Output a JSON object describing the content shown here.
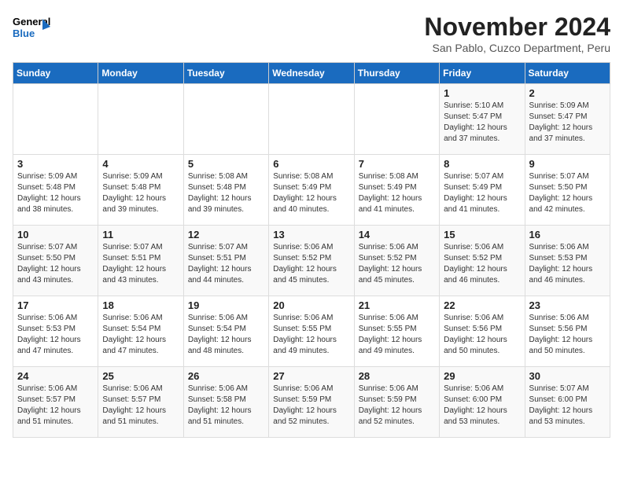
{
  "logo": {
    "line1": "General",
    "line2": "Blue"
  },
  "title": "November 2024",
  "location": "San Pablo, Cuzco Department, Peru",
  "weekdays": [
    "Sunday",
    "Monday",
    "Tuesday",
    "Wednesday",
    "Thursday",
    "Friday",
    "Saturday"
  ],
  "weeks": [
    [
      {
        "day": "",
        "detail": ""
      },
      {
        "day": "",
        "detail": ""
      },
      {
        "day": "",
        "detail": ""
      },
      {
        "day": "",
        "detail": ""
      },
      {
        "day": "",
        "detail": ""
      },
      {
        "day": "1",
        "detail": "Sunrise: 5:10 AM\nSunset: 5:47 PM\nDaylight: 12 hours\nand 37 minutes."
      },
      {
        "day": "2",
        "detail": "Sunrise: 5:09 AM\nSunset: 5:47 PM\nDaylight: 12 hours\nand 37 minutes."
      }
    ],
    [
      {
        "day": "3",
        "detail": "Sunrise: 5:09 AM\nSunset: 5:48 PM\nDaylight: 12 hours\nand 38 minutes."
      },
      {
        "day": "4",
        "detail": "Sunrise: 5:09 AM\nSunset: 5:48 PM\nDaylight: 12 hours\nand 39 minutes."
      },
      {
        "day": "5",
        "detail": "Sunrise: 5:08 AM\nSunset: 5:48 PM\nDaylight: 12 hours\nand 39 minutes."
      },
      {
        "day": "6",
        "detail": "Sunrise: 5:08 AM\nSunset: 5:49 PM\nDaylight: 12 hours\nand 40 minutes."
      },
      {
        "day": "7",
        "detail": "Sunrise: 5:08 AM\nSunset: 5:49 PM\nDaylight: 12 hours\nand 41 minutes."
      },
      {
        "day": "8",
        "detail": "Sunrise: 5:07 AM\nSunset: 5:49 PM\nDaylight: 12 hours\nand 41 minutes."
      },
      {
        "day": "9",
        "detail": "Sunrise: 5:07 AM\nSunset: 5:50 PM\nDaylight: 12 hours\nand 42 minutes."
      }
    ],
    [
      {
        "day": "10",
        "detail": "Sunrise: 5:07 AM\nSunset: 5:50 PM\nDaylight: 12 hours\nand 43 minutes."
      },
      {
        "day": "11",
        "detail": "Sunrise: 5:07 AM\nSunset: 5:51 PM\nDaylight: 12 hours\nand 43 minutes."
      },
      {
        "day": "12",
        "detail": "Sunrise: 5:07 AM\nSunset: 5:51 PM\nDaylight: 12 hours\nand 44 minutes."
      },
      {
        "day": "13",
        "detail": "Sunrise: 5:06 AM\nSunset: 5:52 PM\nDaylight: 12 hours\nand 45 minutes."
      },
      {
        "day": "14",
        "detail": "Sunrise: 5:06 AM\nSunset: 5:52 PM\nDaylight: 12 hours\nand 45 minutes."
      },
      {
        "day": "15",
        "detail": "Sunrise: 5:06 AM\nSunset: 5:52 PM\nDaylight: 12 hours\nand 46 minutes."
      },
      {
        "day": "16",
        "detail": "Sunrise: 5:06 AM\nSunset: 5:53 PM\nDaylight: 12 hours\nand 46 minutes."
      }
    ],
    [
      {
        "day": "17",
        "detail": "Sunrise: 5:06 AM\nSunset: 5:53 PM\nDaylight: 12 hours\nand 47 minutes."
      },
      {
        "day": "18",
        "detail": "Sunrise: 5:06 AM\nSunset: 5:54 PM\nDaylight: 12 hours\nand 47 minutes."
      },
      {
        "day": "19",
        "detail": "Sunrise: 5:06 AM\nSunset: 5:54 PM\nDaylight: 12 hours\nand 48 minutes."
      },
      {
        "day": "20",
        "detail": "Sunrise: 5:06 AM\nSunset: 5:55 PM\nDaylight: 12 hours\nand 49 minutes."
      },
      {
        "day": "21",
        "detail": "Sunrise: 5:06 AM\nSunset: 5:55 PM\nDaylight: 12 hours\nand 49 minutes."
      },
      {
        "day": "22",
        "detail": "Sunrise: 5:06 AM\nSunset: 5:56 PM\nDaylight: 12 hours\nand 50 minutes."
      },
      {
        "day": "23",
        "detail": "Sunrise: 5:06 AM\nSunset: 5:56 PM\nDaylight: 12 hours\nand 50 minutes."
      }
    ],
    [
      {
        "day": "24",
        "detail": "Sunrise: 5:06 AM\nSunset: 5:57 PM\nDaylight: 12 hours\nand 51 minutes."
      },
      {
        "day": "25",
        "detail": "Sunrise: 5:06 AM\nSunset: 5:57 PM\nDaylight: 12 hours\nand 51 minutes."
      },
      {
        "day": "26",
        "detail": "Sunrise: 5:06 AM\nSunset: 5:58 PM\nDaylight: 12 hours\nand 51 minutes."
      },
      {
        "day": "27",
        "detail": "Sunrise: 5:06 AM\nSunset: 5:59 PM\nDaylight: 12 hours\nand 52 minutes."
      },
      {
        "day": "28",
        "detail": "Sunrise: 5:06 AM\nSunset: 5:59 PM\nDaylight: 12 hours\nand 52 minutes."
      },
      {
        "day": "29",
        "detail": "Sunrise: 5:06 AM\nSunset: 6:00 PM\nDaylight: 12 hours\nand 53 minutes."
      },
      {
        "day": "30",
        "detail": "Sunrise: 5:07 AM\nSunset: 6:00 PM\nDaylight: 12 hours\nand 53 minutes."
      }
    ]
  ]
}
